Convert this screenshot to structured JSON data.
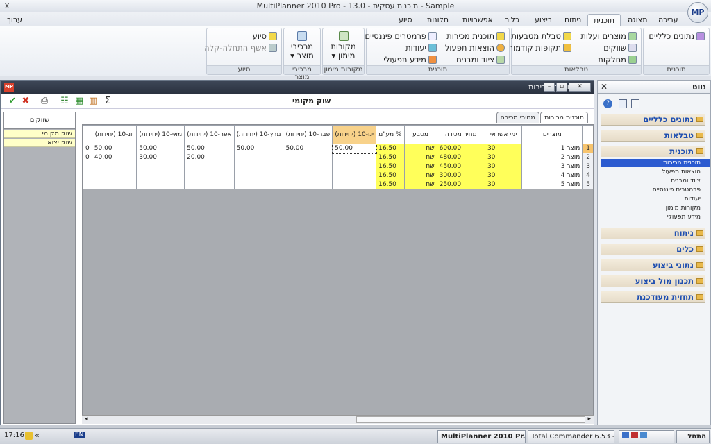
{
  "title_bar": {
    "title": "MultiPlanner 2010 Pro - 13.0 - תוכנית עסקית - Sample",
    "close": "x",
    "right_btns": "_ ▫ ✕"
  },
  "menu": {
    "edit_label": "ערוך",
    "logo": "MP"
  },
  "tabs": [
    "עריכה",
    "תצוגה",
    "תוכנית",
    "ניתוח",
    "ביצוע",
    "כלים",
    "אפשרויות",
    "חלונות",
    "סיוע"
  ],
  "ribbon": {
    "plan_group": {
      "caption": "תוכנית",
      "items": [
        "נתונים כלליים"
      ]
    },
    "tables_group": {
      "caption": "טבלאות",
      "items": [
        "מוצרים ועלות",
        "טבלת מטבעות",
        "שווקים",
        "תקופות קודמות",
        "מחלקות"
      ]
    },
    "plan2_group": {
      "caption": "תוכנית",
      "items": [
        "תוכנית מכירות",
        "פרמטרים פיננסיים",
        "הוצאות תפעול",
        "יעודות",
        "ציוד ומבנים",
        "מידע תפעולי"
      ]
    },
    "funding_group": {
      "caption": "מקורות מימון",
      "button": "מקורות מימון"
    },
    "product_group": {
      "caption": "מרכיבי מוצר",
      "button": "מרכיבי מוצר"
    },
    "help_group": {
      "caption": "סיוע",
      "items": [
        "סיוע",
        "אשף התחלה-קלה"
      ]
    }
  },
  "main_window": {
    "title": "תוכנית מכירות",
    "icon": "MP",
    "market_title": "שוק מקומי",
    "markets_header": "שווקים",
    "markets": [
      "שוק מקומי",
      "שוק יצוא"
    ],
    "sheet_tabs": [
      "תוכנית מכירות",
      "מחירי מכירה"
    ],
    "columns": [
      "מוצרים",
      "ימי אשראי",
      "מחיר מכירה",
      "מטבע",
      "% מע\"מ",
      "ינו-10 (יחידות)",
      "פבר-10 (יחידות)",
      "מרץ-10 (יחידות)",
      "אפר-10 (יחידות)",
      "מאי-10 (יחידות)",
      "יונ-10 (יחידות)"
    ],
    "rows": [
      {
        "n": "1",
        "product": "מוצר 1",
        "credit": "30",
        "price": "600.00",
        "cur": "שח",
        "vat": "16.50",
        "m": [
          "50.00",
          "50.00",
          "50.00",
          "50.00",
          "50.00",
          "50.00"
        ],
        "edge": "0"
      },
      {
        "n": "2",
        "product": "מוצר 2",
        "credit": "30",
        "price": "480.00",
        "cur": "שח",
        "vat": "16.50",
        "m": [
          "",
          "",
          "",
          "20.00",
          "30.00",
          "40.00"
        ],
        "edge": "0"
      },
      {
        "n": "3",
        "product": "מוצר 3",
        "credit": "30",
        "price": "450.00",
        "cur": "שח",
        "vat": "16.50",
        "m": [
          "",
          "",
          "",
          "",
          "",
          ""
        ],
        "edge": ""
      },
      {
        "n": "4",
        "product": "מוצר 4",
        "credit": "30",
        "price": "300.00",
        "cur": "שח",
        "vat": "16.50",
        "m": [
          "",
          "",
          "",
          "",
          "",
          ""
        ],
        "edge": ""
      },
      {
        "n": "5",
        "product": "מוצר 5",
        "credit": "30",
        "price": "250.00",
        "cur": "שח",
        "vat": "16.50",
        "m": [
          "",
          "",
          "",
          "",
          "",
          ""
        ],
        "edge": ""
      }
    ]
  },
  "nav": {
    "title": "נווט",
    "sections": [
      "נתונים כלליים",
      "טבלאות",
      "תוכנית",
      "ניתוח",
      "כלים",
      "נתוני ביצוע",
      "תכנון מול ביצוע",
      "תחזית מעודכנת"
    ],
    "plan_items": [
      "תוכנית מכירות",
      "הוצאות תפעול",
      "ציוד ומבנים",
      "פרמטרים פיננסיים",
      "יעודות",
      "מקורות מימון",
      "מידע תפעולי"
    ]
  },
  "taskbar": {
    "start": "התחל",
    "lang": "EN",
    "clock": "17:16",
    "tasks": [
      "MultiPlanner 2010 Pr...",
      "Total Commander 6.53 - ..."
    ]
  },
  "colors": {
    "accent": "#2c5bd0",
    "yellow": "#ffff5a",
    "titlebar": "#2b3240"
  }
}
